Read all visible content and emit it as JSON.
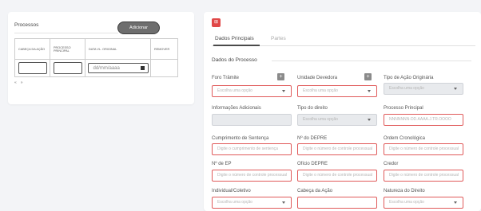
{
  "processos": {
    "title": "Processos",
    "add_label": "Adicionar",
    "columns": [
      "CABEÇA DA AÇÃO",
      "PROCESSO PRINCIPAL",
      "DATA VL. ORIGINAL",
      "REMOVER"
    ],
    "date_placeholder": "dd/mm/aaaa",
    "pager": [
      "«",
      "»"
    ]
  },
  "form": {
    "icon_label": "⊞",
    "tabs": [
      "Dados Principais",
      "Partes"
    ],
    "section_title": "Dados do Processo",
    "fields": [
      {
        "label": "Foro Trâmite",
        "value": "Escolha uma opção"
      },
      {
        "label": "Unidade Devedora",
        "value": "Escolha uma opção"
      },
      {
        "label": "Tipo de Ação Originária",
        "value": "Escolha uma opção"
      },
      {
        "label": "Informações Adicionais",
        "value": ""
      },
      {
        "label": "Tipo do direito",
        "value": "Escolha uma opção"
      },
      {
        "label": "Processo Principal",
        "value": "NNNNNNN-DD.AAAA.J.TR.OOOO"
      },
      {
        "label": "Cumprimento de Sentença",
        "value": "Digite o cumprimento de sentença"
      },
      {
        "label": "Nº do DEPRE",
        "value": "Digite o número de controle processual"
      },
      {
        "label": "Ordem Cronológica",
        "value": "Digite o número de controle processual"
      },
      {
        "label": "Nº de EP",
        "value": "Digite o número de controle processual"
      },
      {
        "label": "Ofício DEPRE",
        "value": "Digite o número de controle processual"
      },
      {
        "label": "Credor",
        "value": "Digite o número de controle processual"
      },
      {
        "label": "Individual/Coletivo",
        "value": "Escolha uma opção"
      },
      {
        "label": "Cabeça da Ação",
        "value": ""
      },
      {
        "label": "Natureza do Direito",
        "value": "Escolha uma opção"
      }
    ]
  }
}
